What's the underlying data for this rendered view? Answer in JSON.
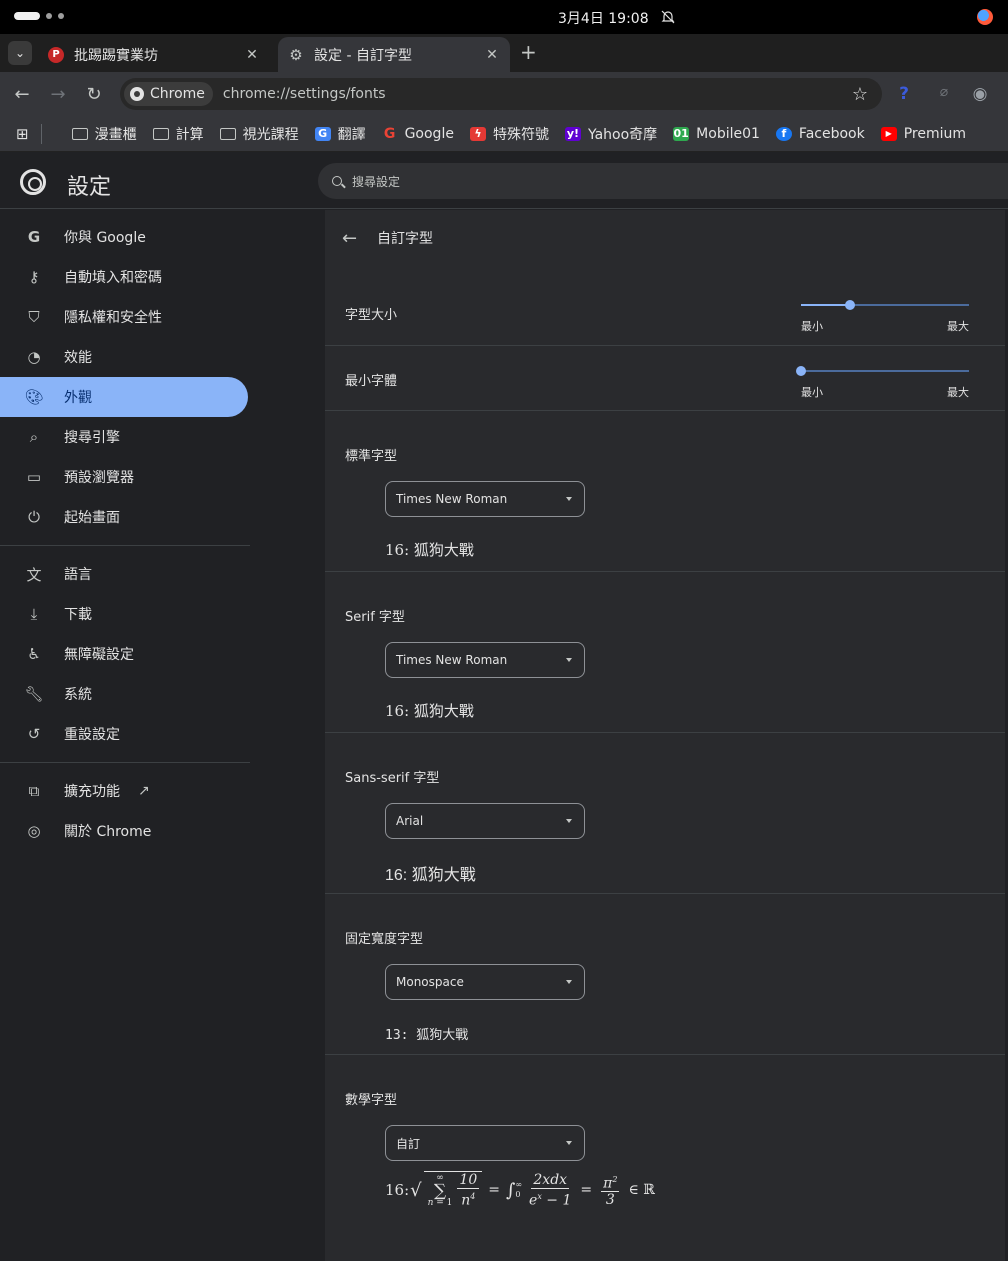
{
  "os": {
    "clock": "3月4日 19:08"
  },
  "tabs": [
    {
      "title": "批踢踢實業坊",
      "favicon": "P",
      "active": false
    },
    {
      "title": "設定 - 自訂字型",
      "favicon": "gear-icon",
      "active": true
    }
  ],
  "toolbar": {
    "chip_label": "Chrome",
    "url": "chrome://settings/fonts"
  },
  "bookmarks": [
    {
      "label": "漫畫櫃",
      "icon": "folder-icon"
    },
    {
      "label": "計算",
      "icon": "folder-icon"
    },
    {
      "label": "視光課程",
      "icon": "folder-icon"
    },
    {
      "label": "翻譯",
      "icon": "google-translate-icon"
    },
    {
      "label": "Google",
      "icon": "google-icon"
    },
    {
      "label": "特殊符號",
      "icon": "special-symbol-icon"
    },
    {
      "label": "Yahoo奇摩",
      "icon": "yahoo-icon"
    },
    {
      "label": "Mobile01",
      "icon": "mobile01-icon"
    },
    {
      "label": "Facebook",
      "icon": "facebook-icon"
    },
    {
      "label": "Premium",
      "icon": "youtube-icon"
    }
  ],
  "header": {
    "title": "設定",
    "search_placeholder": "搜尋設定"
  },
  "sidebar": {
    "items": [
      {
        "label": "你與 Google",
        "icon": "google-g-icon"
      },
      {
        "label": "自動填入和密碼",
        "icon": "key-icon"
      },
      {
        "label": "隱私權和安全性",
        "icon": "shield-icon"
      },
      {
        "label": "效能",
        "icon": "speedometer-icon"
      },
      {
        "label": "外觀",
        "icon": "palette-icon",
        "active": true
      },
      {
        "label": "搜尋引擎",
        "icon": "search-icon"
      },
      {
        "label": "預設瀏覽器",
        "icon": "browser-window-icon"
      },
      {
        "label": "起始畫面",
        "icon": "power-icon"
      },
      {
        "label": "語言",
        "icon": "translate-icon"
      },
      {
        "label": "下載",
        "icon": "download-icon"
      },
      {
        "label": "無障礙設定",
        "icon": "accessibility-icon"
      },
      {
        "label": "系統",
        "icon": "wrench-icon"
      },
      {
        "label": "重設設定",
        "icon": "reset-icon"
      },
      {
        "label": "擴充功能",
        "icon": "puzzle-icon"
      },
      {
        "label": "關於 Chrome",
        "icon": "chrome-icon"
      }
    ]
  },
  "main": {
    "page_title": "自訂字型",
    "font_size": {
      "label": "字型大小",
      "min_label": "最小",
      "max_label": "最大",
      "value_fraction": 0.29
    },
    "min_font": {
      "label": "最小字體",
      "min_label": "最小",
      "max_label": "最大",
      "value_fraction": 0.0
    },
    "standard": {
      "label": "標準字型",
      "value": "Times New Roman",
      "sample": "16: 狐狗大戰"
    },
    "serif": {
      "label": "Serif 字型",
      "value": "Times New Roman",
      "sample": "16: 狐狗大戰"
    },
    "sans": {
      "label": "Sans-serif 字型",
      "value": "Arial",
      "sample": "16: 狐狗大戰"
    },
    "fixed": {
      "label": "固定寬度字型",
      "value": "Monospace",
      "sample": "13: 狐狗大戰"
    },
    "math": {
      "label": "數學字型",
      "value": "自訂",
      "sample_prefix": "16:"
    }
  },
  "colors": {
    "accent": "#8ab4f8",
    "background": "#202124",
    "panel": "#292a2d"
  }
}
